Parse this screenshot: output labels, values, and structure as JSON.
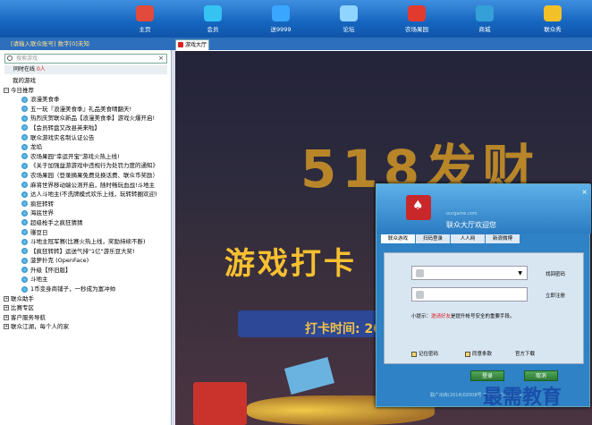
{
  "nav": [
    {
      "label": "主页",
      "icon": "home-icon",
      "color": "#e24a3c"
    },
    {
      "label": "会员",
      "icon": "diamond-icon",
      "color": "#35c3f2"
    },
    {
      "label": "送9999",
      "icon": "globe-icon",
      "color": "#3aa6ff"
    },
    {
      "label": "论坛",
      "icon": "chat-bubble-icon",
      "color": "#8fd5ff"
    },
    {
      "label": "农场果园",
      "icon": "apple-icon",
      "color": "#e23b2e"
    },
    {
      "label": "商城",
      "icon": "cart-icon",
      "color": "#34a0d8"
    },
    {
      "label": "联众秀",
      "icon": "tshirt-icon",
      "color": "#f2c027"
    }
  ],
  "status": "[请输入联众账号] 数字[0]未知",
  "tab": {
    "label": "游戏大厅"
  },
  "search": {
    "placeholder": "搜索游戏"
  },
  "online": {
    "label": "同时在线",
    "count": "0人"
  },
  "tree": [
    {
      "label": "我的游戏",
      "lv": 0,
      "type": "plain"
    },
    {
      "label": "今日推荐",
      "lv": 0,
      "type": "minus"
    },
    {
      "label": "浪漫美食季",
      "lv": 2,
      "type": "ie"
    },
    {
      "label": "五一玩『浪漫美食季』礼品美食晴翻天!",
      "lv": 2,
      "type": "ie"
    },
    {
      "label": "热烈庆贺联众新品【浪漫美食季】游戏火爆开启!",
      "lv": 2,
      "type": "ie"
    },
    {
      "label": "【会员转盘又改县英来啦】",
      "lv": 2,
      "type": "ie"
    },
    {
      "label": "联众游戏实名制认证公告",
      "lv": 2,
      "type": "ie"
    },
    {
      "label": "龙焰",
      "lv": 2,
      "type": "ie"
    },
    {
      "label": "农场果园\"幸运开宝\"游戏火热上线!",
      "lv": 2,
      "type": "ie"
    },
    {
      "label": "《关于加强益游游戏中违规行为处罚力度的通知》",
      "lv": 2,
      "type": "ie"
    },
    {
      "label": "农场果园（登录摘果免费兑换话费、联众币奖励）",
      "lv": 2,
      "type": "ie"
    },
    {
      "label": "麻将世界移动端公测开启，随时畅玩血战!斗地主",
      "lv": 2,
      "type": "ie"
    },
    {
      "label": "达人斗地主(不洗牌模式欢乐上线，玩转转圈欢迎)",
      "lv": 2,
      "type": "ie"
    },
    {
      "label": "疯狂转转",
      "lv": 2,
      "type": "ie"
    },
    {
      "label": "海底世界",
      "lv": 2,
      "type": "ie"
    },
    {
      "label": "超级枪手之疯狂猜猜",
      "lv": 2,
      "type": "ie"
    },
    {
      "label": "赚豆日",
      "lv": 2,
      "type": "ie"
    },
    {
      "label": "斗地主冠军赛(比赛火热上线，奖励持续不断)",
      "lv": 2,
      "type": "ie"
    },
    {
      "label": "【疯狂转转】运送气排\"1亿\"游乐豆大奖!",
      "lv": 2,
      "type": "ie"
    },
    {
      "label": "菠萝扑克 (OpenFace)",
      "lv": 2,
      "type": "ie"
    },
    {
      "label": "升级【怀旧版】",
      "lv": 2,
      "type": "ie"
    },
    {
      "label": "斗地主",
      "lv": 2,
      "type": "ie"
    },
    {
      "label": "1币变身商铺子，一秒成为富冲帅",
      "lv": 2,
      "type": "ie"
    },
    {
      "label": "联众助手",
      "lv": 0,
      "type": "plus"
    },
    {
      "label": "比赛专区",
      "lv": 0,
      "type": "plus"
    },
    {
      "label": "客户服务导航",
      "lv": 0,
      "type": "plus"
    },
    {
      "label": "联众江湖，每个人的家",
      "lv": 0,
      "type": "plus"
    }
  ],
  "banner": {
    "big": "518发财",
    "mid": "游戏打卡",
    "punch": "打卡时间: 20"
  },
  "login": {
    "domain": "ourgame.com",
    "welcome": "联众大厅欢迎您",
    "tabs": [
      "联众游戏",
      "扫码登录",
      "人人网",
      "新浪微博"
    ],
    "find_password": "找回密码",
    "register": "立即注册",
    "tip_prefix": "小提示：",
    "tip_red": "邀请好友",
    "tip_rest": "是提升帐号安全的重要手段。",
    "remember": "记住密码",
    "agree": "同意条款",
    "download": "官方下载",
    "login_btn": "登录",
    "cancel_btn": "取消",
    "copyright": "联广出库(2014)02008号 ©1998-2016 联众",
    "close": "×"
  },
  "watermark": "最需教育"
}
